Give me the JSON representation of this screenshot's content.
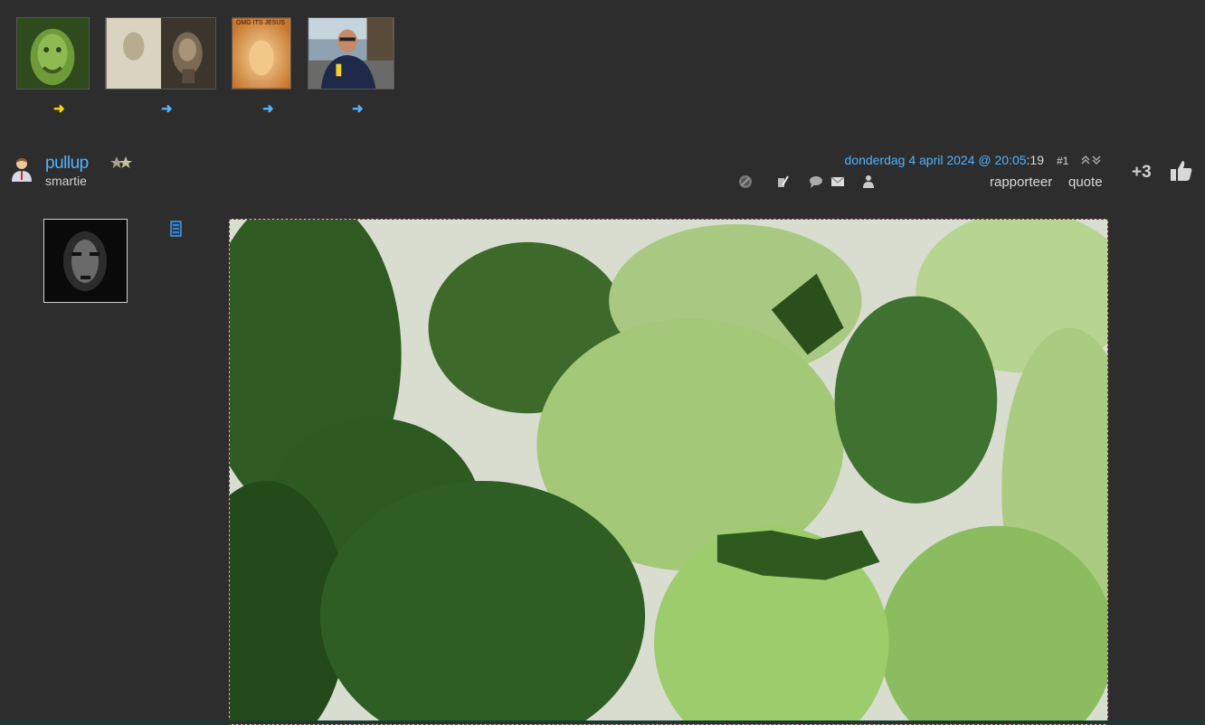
{
  "thumbnails": [
    {
      "name": "green-face-thumb",
      "arrow": "➜",
      "arrow_color": "#ffd700"
    },
    {
      "name": "shroud-thumb",
      "arrow": "➜",
      "arrow_color": "#4fb3ff"
    },
    {
      "name": "omg-jesus-thumb",
      "caption": "OMG ITS JESUS",
      "arrow": "➜",
      "arrow_color": "#4fb3ff"
    },
    {
      "name": "man-photo-thumb",
      "arrow": "➜",
      "arrow_color": "#4fb3ff"
    }
  ],
  "post": {
    "username": "pullup",
    "user_title": "smartie",
    "date_link": "donderdag 4 april 2024 @ 20:05",
    "date_seconds": ":19",
    "post_number": "#1",
    "actions": {
      "report": "rapporteer",
      "quote": "quote"
    },
    "icons": [
      "block-icon",
      "edit-icon",
      "comment-icon",
      "mail-icon",
      "user-info-icon"
    ],
    "vote_score": "+3"
  },
  "colors": {
    "background": "#2d2d2d",
    "link": "#4fb3ff",
    "text": "#d8d8d8",
    "highlight_arrow": "#ffd700"
  }
}
